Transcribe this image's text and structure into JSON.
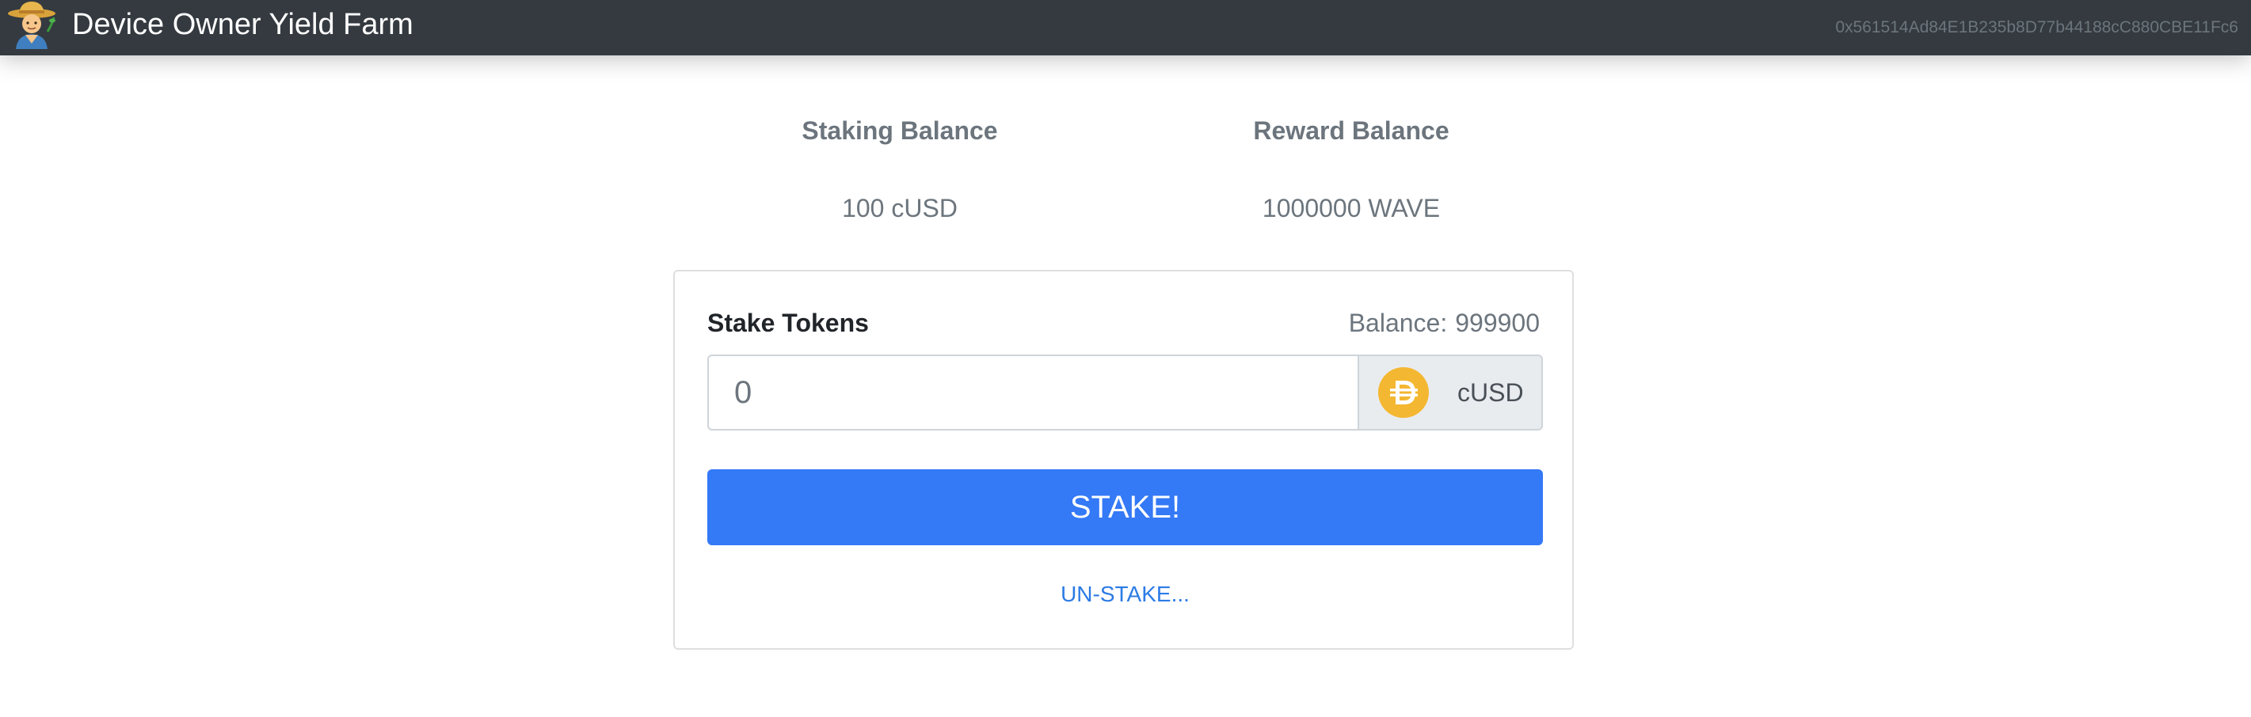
{
  "navbar": {
    "title": "Device Owner Yield Farm",
    "logo_icon": "farmer-emoji-icon",
    "account": "0x561514Ad84E1B235b8D77b44188cC880CBE11Fc6"
  },
  "balances": {
    "staking_label": "Staking Balance",
    "staking_value": "100 cUSD",
    "reward_label": "Reward Balance",
    "reward_value": "1000000 WAVE"
  },
  "stake_form": {
    "title": "Stake Tokens",
    "balance_label": "Balance:",
    "balance_value": "999900",
    "amount_placeholder": "0",
    "token_icon": "dai-token-icon",
    "token_label": "cUSD",
    "stake_button": "STAKE!",
    "unstake_link": "UN-STAKE..."
  },
  "colors": {
    "navbar_bg": "#343a40",
    "primary": "#3479f6",
    "link": "#2c7be5",
    "token_gold": "#f4b731",
    "muted_text": "#6c757d"
  }
}
